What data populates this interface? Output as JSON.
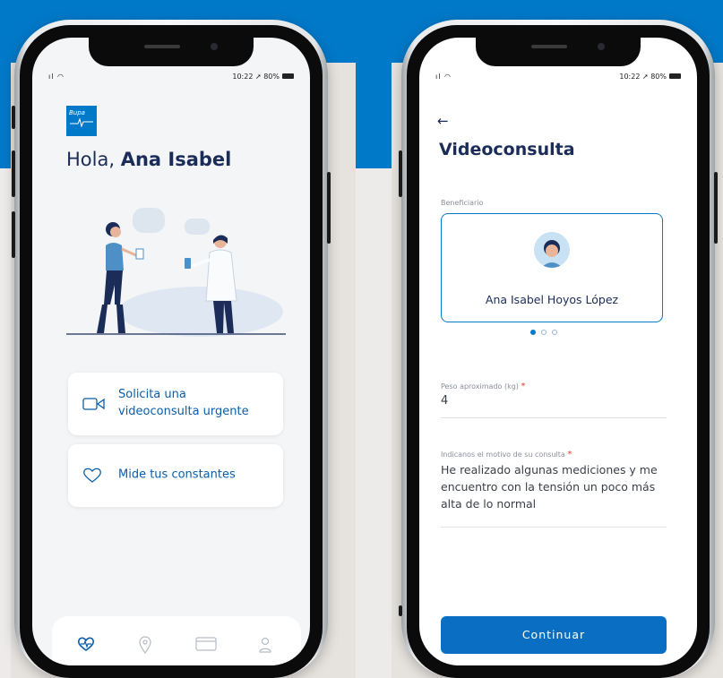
{
  "home": {
    "status_time": "10:22",
    "status_battery": "80%",
    "logo_text": "Bupa",
    "greeting_prefix": "Hola, ",
    "greeting_name": "Ana Isabel",
    "card_video_label": "Solicita una videoconsulta urgente",
    "card_vitals_label": "Mide tus constantes",
    "nav": [
      "health",
      "location",
      "card",
      "profile"
    ]
  },
  "videoconsulta": {
    "status_time": "10:22",
    "status_battery": "80%",
    "title": "Videoconsulta",
    "beneficiary_label": "Beneficiario",
    "beneficiary_name": "Ana Isabel Hoyos López",
    "weight_label": "Peso aproximado (kg)",
    "weight_value": "4",
    "reason_label": "Indicanos el motivo de su consulta",
    "reason_value": "He realizado algunas mediciones y me encuentro con la tensión un poco más alta de lo normal",
    "continue_label": "Continuar",
    "carousel_pages": 3,
    "carousel_active": 1
  },
  "colors": {
    "brand_blue": "#0079c8",
    "title_navy": "#1b2c59",
    "button_blue": "#0a6fc2",
    "required_red": "#e03a2e"
  }
}
